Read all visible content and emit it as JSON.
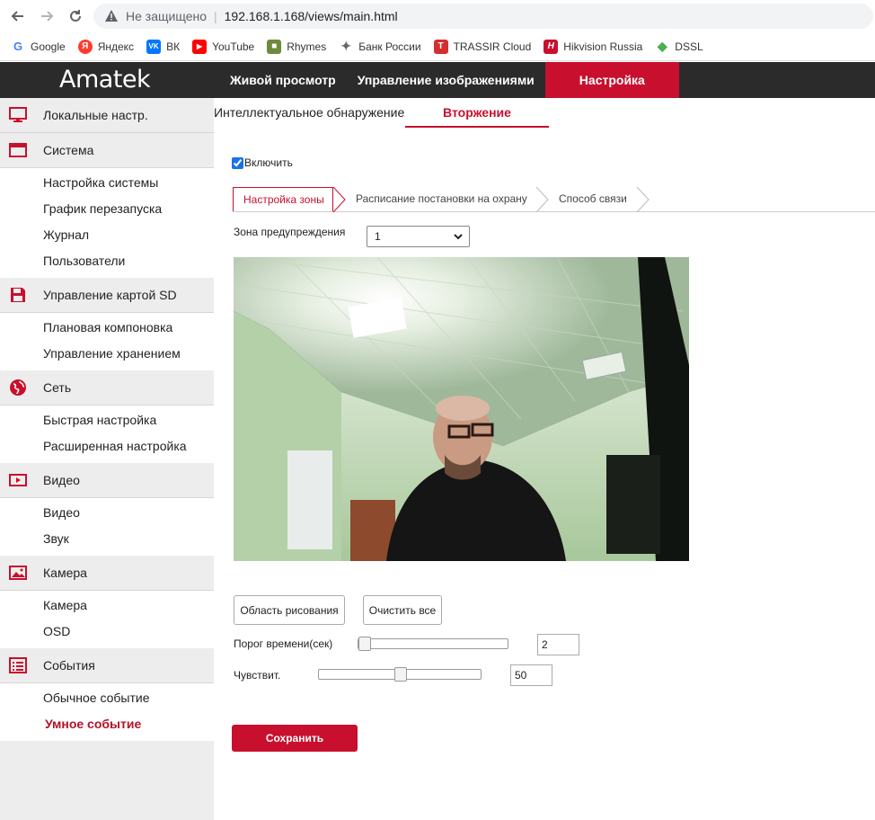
{
  "browser": {
    "insecure_label": "Не защищено",
    "url": "192.168.1.168/views/main.html",
    "bookmarks": [
      {
        "label": "Google",
        "icon": "google-icon",
        "color": "#4285f4"
      },
      {
        "label": "Яндекс",
        "icon": "yandex-icon",
        "color": "#ff0000"
      },
      {
        "label": "ВК",
        "icon": "vk-icon",
        "color": "#0077ff"
      },
      {
        "label": "YouTube",
        "icon": "youtube-icon",
        "color": "#ff0000"
      },
      {
        "label": "Rhymes",
        "icon": "rhymes-icon",
        "color": "#6d8b3c"
      },
      {
        "label": "Банк России",
        "icon": "bank-russia-icon",
        "color": "#666666"
      },
      {
        "label": "TRASSIR Cloud",
        "icon": "trassir-icon",
        "color": "#d32f2f"
      },
      {
        "label": "Hikvision Russia",
        "icon": "hikvision-icon",
        "color": "#c8102e"
      },
      {
        "label": "DSSL",
        "icon": "dssl-icon",
        "color": "#4caf50"
      }
    ]
  },
  "app": {
    "logo": "Amatek",
    "accent": "#c8102e",
    "topnav": [
      "Живой просмотр",
      "Управление изображениями",
      "Настройка"
    ]
  },
  "sidebar": {
    "sections": [
      {
        "label": "Локальные настр.",
        "icon": "monitor-icon",
        "items": []
      },
      {
        "label": "Система",
        "icon": "window-icon",
        "items": [
          "Настройка системы",
          "График перезапуска",
          "Журнал",
          "Пользователи"
        ]
      },
      {
        "label": "Управление картой SD",
        "icon": "floppy-icon",
        "items": [
          "Плановая компоновка",
          "Управление хранением"
        ]
      },
      {
        "label": "Сеть",
        "icon": "globe-icon",
        "items": [
          "Быстрая настройка",
          "Расширенная настройка"
        ]
      },
      {
        "label": "Видео",
        "icon": "video-icon",
        "items": [
          "Видео",
          "Звук"
        ]
      },
      {
        "label": "Камера",
        "icon": "image-icon",
        "items": [
          "Камера",
          "OSD"
        ]
      },
      {
        "label": "События",
        "icon": "list-icon",
        "items": [
          "Обычное событие",
          "Умное событие"
        ]
      }
    ]
  },
  "content": {
    "tabs": [
      "Интеллектуальное обнаружение",
      "Вторжение"
    ],
    "enable_label": "Включить",
    "subtabs": [
      "Настройка зоны",
      "Расписание постановки на охрану",
      "Способ связи"
    ],
    "zone_label": "Зона предупреждения",
    "zone_value": "1",
    "draw_button": "Область рисования",
    "clear_button": "Очистить все",
    "time_threshold_label": "Порог времени(сек)",
    "time_threshold_value": "2",
    "sensitivity_label": "Чувствит.",
    "sensitivity_value": "50",
    "save_button": "Сохранить"
  }
}
